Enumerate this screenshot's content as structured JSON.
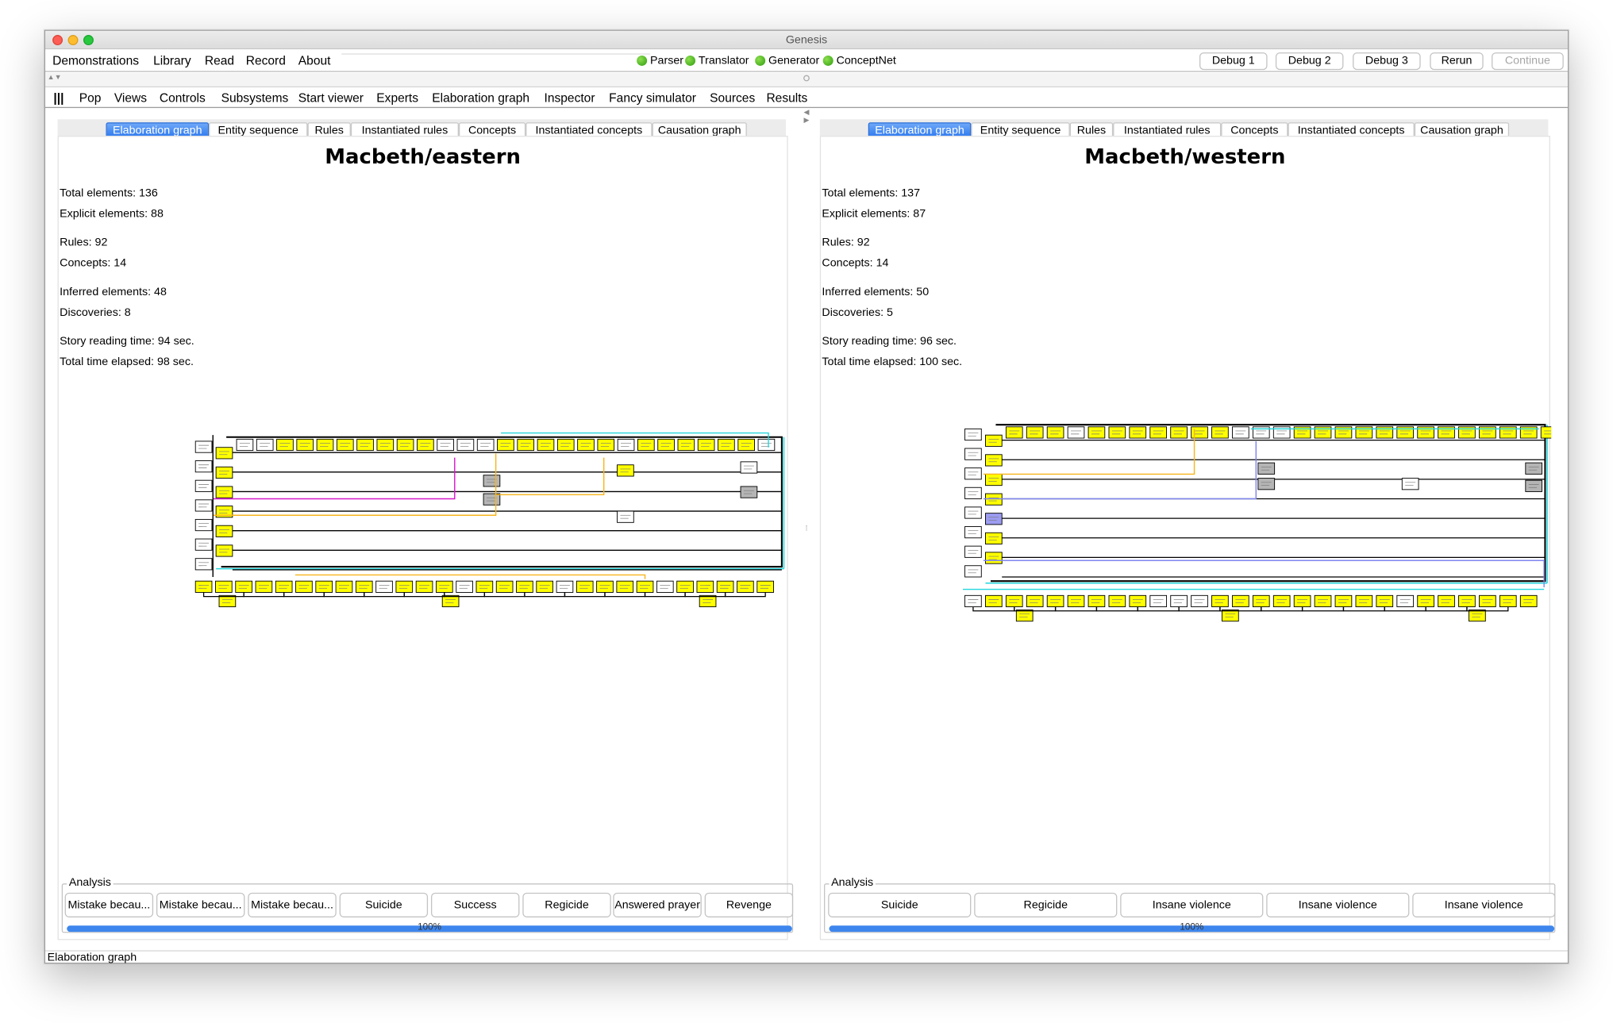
{
  "window": {
    "title": "Genesis"
  },
  "menu": {
    "items": [
      "Demonstrations",
      "Library",
      "Read",
      "Record",
      "About"
    ]
  },
  "status_indicators": [
    "Parser",
    "Translator",
    "Generator",
    "ConceptNet"
  ],
  "toolbar": {
    "buttons": [
      "Debug 1",
      "Debug 2",
      "Debug 3",
      "Rerun",
      "Continue"
    ]
  },
  "submenu": {
    "handle": "|||",
    "items": [
      "Pop",
      "Views",
      "Controls",
      "Subsystems",
      "Start viewer",
      "Experts",
      "Elaboration graph",
      "Inspector",
      "Fancy simulator",
      "Sources",
      "Results"
    ]
  },
  "tabs": [
    "Elaboration graph",
    "Entity sequence",
    "Rules",
    "Instantiated rules",
    "Concepts",
    "Instantiated concepts",
    "Causation graph"
  ],
  "panels": [
    {
      "title": "Macbeth/eastern",
      "stats": [
        "Total elements: 136",
        "Explicit elements: 88",
        "Rules: 92",
        "Concepts: 14",
        "Inferred elements: 48",
        "Discoveries: 8",
        "Story reading time: 94 sec.",
        "Total time elapsed: 98 sec."
      ],
      "analysis_label": "Analysis",
      "analysis_buttons": [
        "Mistake becau...",
        "Mistake becau...",
        "Mistake becau...",
        "Suicide",
        "Success",
        "Regicide",
        "Answered prayer",
        "Revenge"
      ],
      "progress": "100%"
    },
    {
      "title": "Macbeth/western",
      "stats": [
        "Total elements: 137",
        "Explicit elements: 87",
        "Rules: 92",
        "Concepts: 14",
        "Inferred elements: 50",
        "Discoveries: 5",
        "Story reading time: 96 sec.",
        "Total time elapsed: 100 sec."
      ],
      "analysis_label": "Analysis",
      "analysis_buttons": [
        "Suicide",
        "Regicide",
        "Insane violence",
        "Insane violence",
        "Insane violence"
      ],
      "progress": "100%"
    }
  ],
  "statusbar": {
    "text": "Elaboration graph"
  },
  "colors": {
    "node_yellow": "#ffff00",
    "node_gray": "#b5b5b5",
    "node_blue": "#9c9cf2",
    "tab_active": "#2a76ee",
    "progress": "#3d86ee",
    "edge_magenta": "#d619c9",
    "edge_orange": "#f7b51b",
    "edge_cyan": "#22d6dc",
    "edge_blue": "#7f85f0"
  }
}
